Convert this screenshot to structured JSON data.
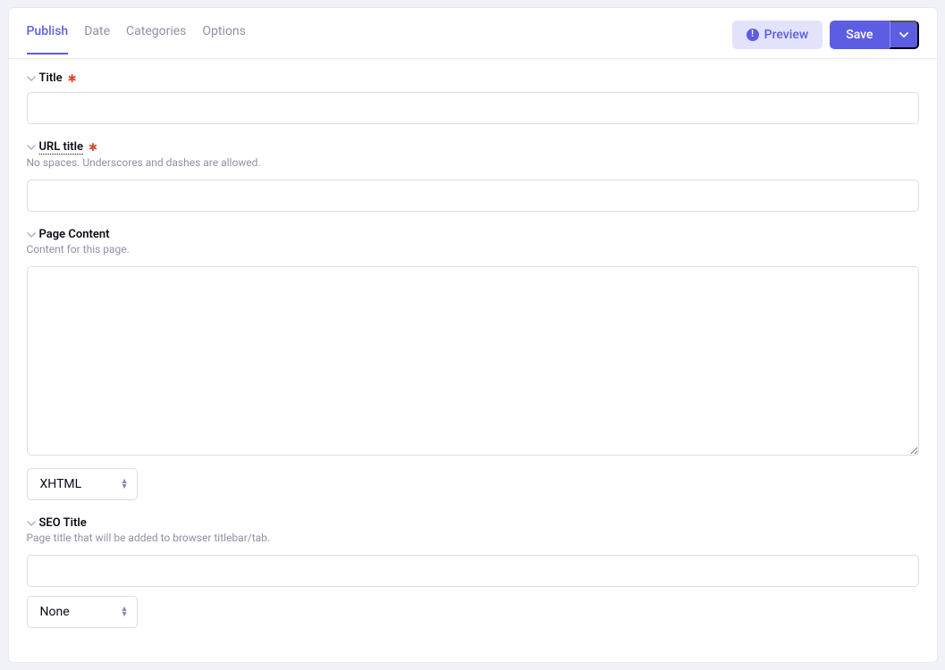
{
  "tabs": {
    "publish": "Publish",
    "date": "Date",
    "categories": "Categories",
    "options": "Options"
  },
  "actions": {
    "preview": "Preview",
    "save": "Save"
  },
  "fields": {
    "title": {
      "label": "Title",
      "value": ""
    },
    "url_title": {
      "label": "URL title",
      "desc": "No spaces. Underscores and dashes are allowed.",
      "value": ""
    },
    "page_content": {
      "label": "Page Content",
      "desc": "Content for this page.",
      "value": "",
      "format_selected": "XHTML"
    },
    "seo_title": {
      "label": "SEO Title",
      "desc": "Page title that will be added to browser titlebar/tab.",
      "value": "",
      "option_selected": "None"
    }
  }
}
